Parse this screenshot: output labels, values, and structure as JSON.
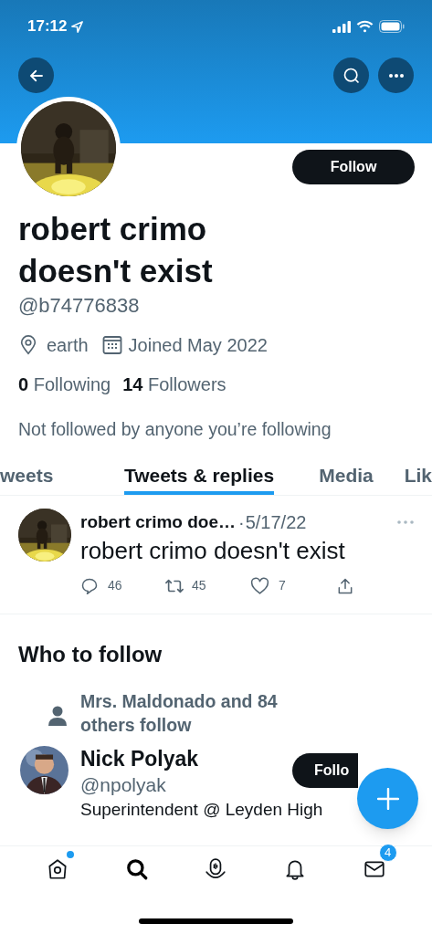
{
  "status_bar": {
    "time": "17:12"
  },
  "profile": {
    "name": "robert crimo doesn't exist",
    "handle": "@b74776838",
    "location": "earth",
    "joined": "Joined May 2022",
    "following_count": "0",
    "following_label": "Following",
    "followers_count": "14",
    "followers_label": "Followers",
    "followed_by": "Not followed by anyone you’re following",
    "follow_button": "Follow"
  },
  "tabs": [
    {
      "label": "weets",
      "selected": false
    },
    {
      "label": "Tweets & replies",
      "selected": true
    },
    {
      "label": "Media",
      "selected": false
    },
    {
      "label": "Lik",
      "selected": false
    }
  ],
  "tweet": {
    "author": "robert crimo doe…",
    "separator": "·",
    "date": "5/17/22",
    "text": "robert crimo doesn't exist",
    "replies": "46",
    "retweets": "45",
    "likes": "7"
  },
  "who_to_follow": {
    "title": "Who to follow",
    "suggestions": [
      {
        "social_context": "Mrs. Maldonado and 84 others follow",
        "name": "Nick Polyak",
        "handle": "@npolyak",
        "bio": "Superintendent @ Leyden High",
        "follow_button": "Follo"
      }
    ]
  },
  "bottom_nav": [
    {
      "kind": "home",
      "selected": false,
      "unread_dot": true
    },
    {
      "kind": "search",
      "selected": true
    },
    {
      "kind": "spaces",
      "selected": false
    },
    {
      "kind": "notifications",
      "selected": false
    },
    {
      "kind": "messages",
      "selected": false,
      "badge": "4"
    }
  ]
}
